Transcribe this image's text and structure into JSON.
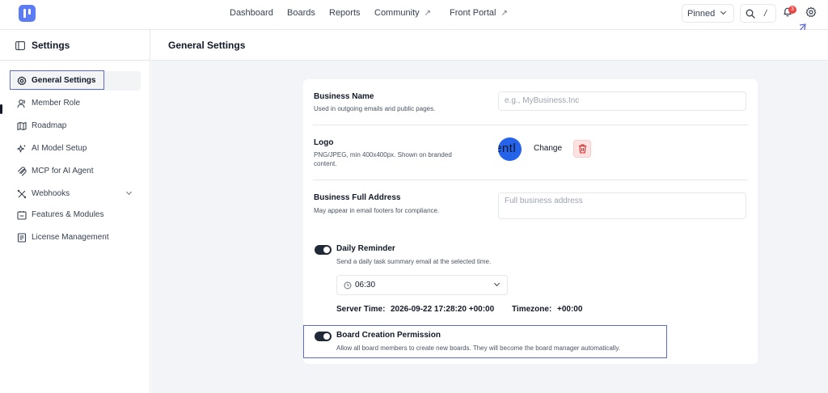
{
  "topnav": {
    "items": [
      {
        "label": "Dashboard",
        "external": false
      },
      {
        "label": "Boards",
        "external": false
      },
      {
        "label": "Reports",
        "external": false
      },
      {
        "label": "Community",
        "external": true
      },
      {
        "label": "Front Portal",
        "external": true
      }
    ],
    "pinned_label": "Pinned",
    "search_shortcut": "/",
    "notification_count": "3"
  },
  "sidebar": {
    "title": "Settings",
    "items": [
      {
        "label": "General Settings",
        "icon": "gear-icon",
        "active": true
      },
      {
        "label": "Member Role",
        "icon": "users-icon"
      },
      {
        "label": "Roadmap",
        "icon": "map-icon"
      },
      {
        "label": "AI Model Setup",
        "icon": "sparkles-icon"
      },
      {
        "label": "MCP for AI Agent",
        "icon": "mcp-icon"
      },
      {
        "label": "Webhooks",
        "icon": "webhook-icon",
        "expandable": true
      },
      {
        "label": "Features & Modules",
        "icon": "modules-icon"
      },
      {
        "label": "License Management",
        "icon": "license-icon"
      }
    ]
  },
  "main": {
    "title": "General Settings",
    "business_name": {
      "label": "Business Name",
      "description": "Used in outgoing emails and public pages.",
      "placeholder": "e.g., MyBusiness.Inc"
    },
    "logo": {
      "label": "Logo",
      "description": "PNG/JPEG, min 400x400px. Shown on branded content.",
      "avatar_text": "entl",
      "change_label": "Change"
    },
    "business_address": {
      "label": "Business Full Address",
      "description": "May appear in email footers for compliance.",
      "placeholder": "Full business address"
    },
    "daily_reminder": {
      "label": "Daily Reminder",
      "description": "Send a daily task summary email at the selected time.",
      "enabled": true,
      "time": "06:30",
      "server_time_label": "Server Time:",
      "server_time_value": "2026-09-22 17:28:20 +00:00",
      "timezone_label": "Timezone:",
      "timezone_value": "+00:00"
    },
    "board_creation": {
      "label": "Board Creation Permission",
      "description": "Allow all board members to create new boards. They will become the board manager automatically.",
      "enabled": true
    }
  },
  "colors": {
    "accent": "#5b7cf5",
    "annotation": "#5d6bd1",
    "danger": "#ef4444",
    "toggle_on": "#1f2937"
  }
}
